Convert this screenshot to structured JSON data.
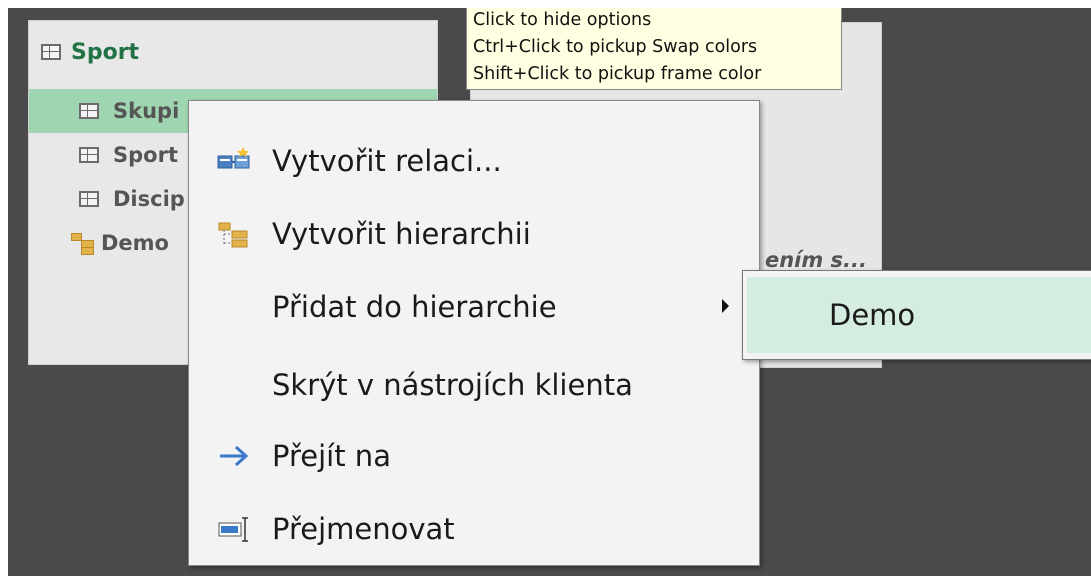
{
  "table_card": {
    "title": "Sport",
    "rows": [
      {
        "label": "Skupi",
        "icon": "table-icon",
        "selected": true
      },
      {
        "label": "Sport",
        "icon": "table-icon",
        "selected": false
      },
      {
        "label": "Discip",
        "icon": "table-icon",
        "selected": false
      },
      {
        "label": "Demo",
        "icon": "hierarchy-icon",
        "selected": false
      }
    ]
  },
  "right_card": {
    "partial_text": "ením s..."
  },
  "tooltip": {
    "lines": [
      "Click to hide options",
      "Ctrl+Click to pickup Swap colors",
      "Shift+Click to pickup frame color"
    ]
  },
  "context_menu": {
    "items": [
      {
        "label": "Vytvořit relaci...",
        "icon": "create-relationship-icon"
      },
      {
        "label": "Vytvořit hierarchii",
        "icon": "create-hierarchy-icon"
      },
      {
        "label": "Přidat do hierarchie",
        "icon": "",
        "has_submenu": true
      },
      {
        "label": "Skrýt v nástrojích klienta",
        "icon": ""
      },
      {
        "label": "Přejít na",
        "icon": "arrow-right-icon"
      },
      {
        "label": "Přejmenovat",
        "icon": "rename-icon"
      }
    ]
  },
  "submenu": {
    "items": [
      {
        "label": "Demo"
      }
    ]
  },
  "colors": {
    "background": "#4a4a4a",
    "card_title": "#217346",
    "selected_row": "#9fd5b0",
    "tooltip_bg": "#ffffe1",
    "submenu_highlight": "#d4ede0",
    "arrow_icon": "#3a78c9"
  }
}
